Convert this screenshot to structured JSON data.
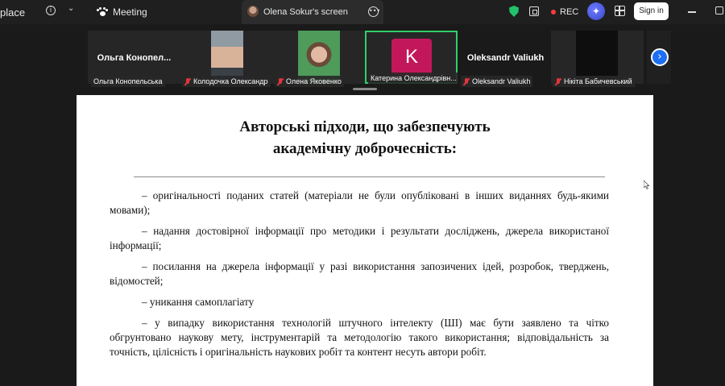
{
  "topbar": {
    "app_name": "place",
    "meeting_label": "Meeting",
    "share_title": "Olena Sokur's screen",
    "rec_label": "REC",
    "sign_in_label": "Sign in",
    "colors": {
      "shield": "#23c16b",
      "rec_dot": "#ff3b3b",
      "ai": "#3a47c9"
    }
  },
  "gallery": {
    "participants": [
      {
        "big_name": "Ольга Конопел...",
        "label": "Ольга Конопельська",
        "muted": false
      },
      {
        "label": "Колодочка Олександр",
        "muted": true
      },
      {
        "label": "Олена Яковенко",
        "muted": true
      },
      {
        "avatar_letter": "K",
        "label": "Катерина Олександрівн...",
        "muted": false,
        "active": true
      },
      {
        "big_name": "Oleksandr Valiukh",
        "label": "Oleksandr Valiukh",
        "muted": true
      },
      {
        "label": "Нікіта Бабичевський",
        "muted": true
      }
    ],
    "active_border_color": "#2fd06a",
    "avatar_color": "#c2185b"
  },
  "slide": {
    "title_line1": "Авторські підходи, що забезпечують",
    "title_line2": "академічну доброчесність:",
    "items": [
      "– оригінальності поданих статей (матеріали не були опубліковані в інших виданнях будь-якими мовами);",
      "– надання достовірної інформації про методики і результати досліджень, джерела використаної інформації;",
      "– посилання на джерела інформації у разі використання запозичених ідей, розробок, тверджень, відомостей;",
      "– уникання самоплагіату",
      "– у випадку використання технологій штучного інтелекту (ШІ) має бути заявлено та чітко обгрунтовано наукову мету, інструментарій та методологію такого використання; відповідальність за точність, цілісність і оригінальність наукових робіт та контент несуть автори робіт."
    ]
  }
}
